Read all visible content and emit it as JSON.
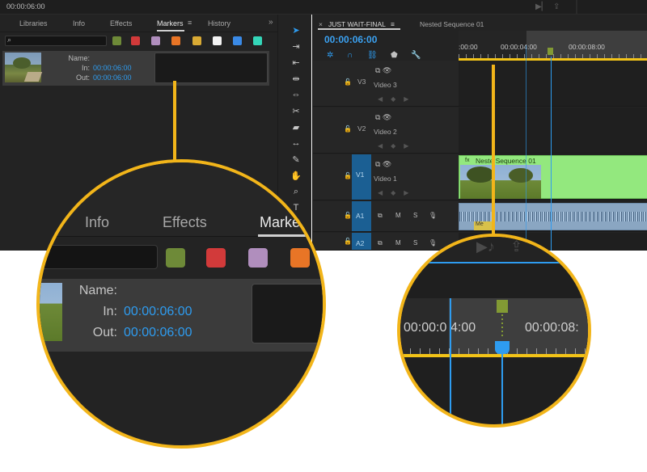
{
  "topbar": {
    "timecode": "00:00:06:00",
    "icons": [
      "play-out-icon",
      "export-icon"
    ]
  },
  "markers_panel": {
    "tabs": [
      {
        "label": "Libraries",
        "active": false
      },
      {
        "label": "Info",
        "active": false
      },
      {
        "label": "Effects",
        "active": false
      },
      {
        "label": "Markers",
        "active": true
      },
      {
        "label": "History",
        "active": false
      }
    ],
    "overflow_icon": "chevron-right-icon",
    "color_filters": [
      "#6e8a38",
      "#d23a3a",
      "#b08ebd",
      "#e87526",
      "#d9aa34",
      "#f2f2f2",
      "#3a8ae6",
      "#34d6b8"
    ],
    "marker": {
      "name_label": "Name:",
      "in_label": "In:",
      "in_value": "00:00:06:00",
      "out_label": "Out:",
      "out_value": "00:00:06:00",
      "name_value": ""
    }
  },
  "tools": [
    "selection-tool-icon",
    "track-select-tool-icon",
    "ripple-edit-tool-icon",
    "rolling-edit-tool-icon",
    "rate-stretch-tool-icon",
    "razor-tool-icon",
    "slip-tool-icon",
    "slide-tool-icon",
    "pen-tool-icon",
    "hand-tool-icon",
    "zoom-tool-icon"
  ],
  "timeline": {
    "tabs": [
      {
        "label": "JUST WAIT-FINAL",
        "active": true
      },
      {
        "label": "Nested Sequence 01",
        "active": false
      }
    ],
    "close_glyph": "×",
    "menu_glyph": "≡",
    "timecode": "00:00:06:00",
    "ruler_labels": [
      ":00:00",
      "00:00:04:00",
      "00:00:08:00"
    ],
    "tracks": [
      {
        "id": "V3",
        "name": "Video 3",
        "targeted": false
      },
      {
        "id": "V2",
        "name": "Video 2",
        "targeted": false
      },
      {
        "id": "V1",
        "name": "Video 1",
        "targeted": true
      },
      {
        "id": "A1",
        "name": "",
        "targeted": true
      },
      {
        "id": "A2",
        "name": "",
        "targeted": true
      }
    ],
    "audio_buttons": {
      "mute": "M",
      "solo": "S"
    },
    "video_clip_title": "Neste  Sequence 01",
    "fx_badge": "fx",
    "audio_meta_badge": "Me"
  },
  "zoom_markers": {
    "tabs": [
      {
        "label": "Info",
        "active": false
      },
      {
        "label": "Effects",
        "active": false
      },
      {
        "label": "Marke",
        "active": true
      }
    ],
    "chips": [
      "#6e8a38",
      "#d23a3a",
      "#b08ebd",
      "#e87526"
    ],
    "name_label": "Name:",
    "in_label": "In:",
    "in_value": "00:00:06:00",
    "out_label": "Out:",
    "out_value": "00:00:06:00"
  },
  "zoom_timeline": {
    "ruler_labels": [
      "00:00:0",
      "4:00",
      "00:00:08:"
    ]
  }
}
